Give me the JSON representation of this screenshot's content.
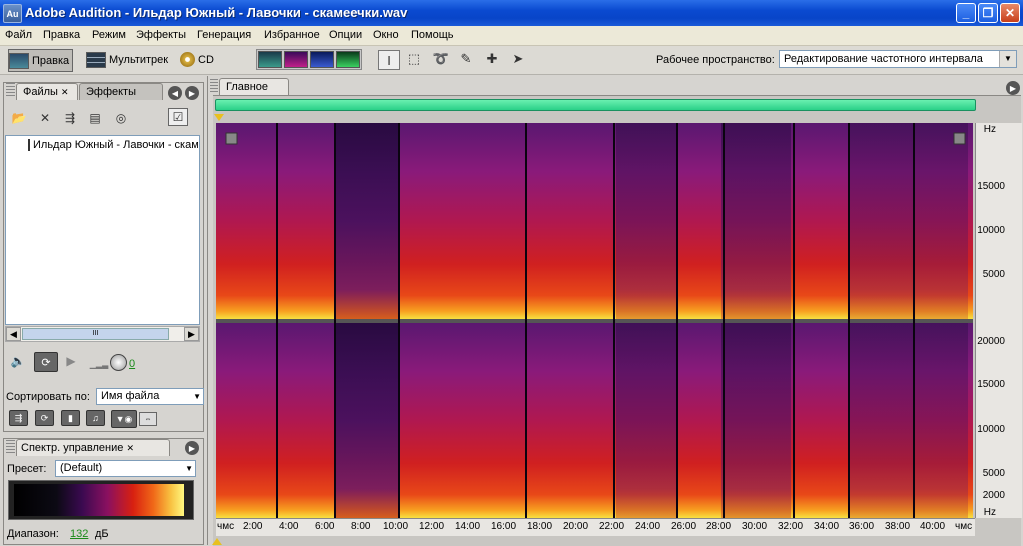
{
  "window": {
    "icon": "Au",
    "title": "Adobe Audition - Ильдар Южный - Лавочки - скамеечки.wav"
  },
  "menu": [
    "Файл",
    "Правка",
    "Режим",
    "Эффекты",
    "Генерация",
    "Избранное",
    "Опции",
    "Окно",
    "Помощь"
  ],
  "toolbar": {
    "edit_label": "Правка",
    "multitrack_label": "Мультитрек",
    "cd_label": "CD",
    "workspace_label": "Рабочее пространство:",
    "workspace_value": "Редактирование частотного интервала"
  },
  "left_panel": {
    "tabs": [
      "Файлы",
      "Эффекты"
    ],
    "file_item": "Ильдар Южный - Лавочки - скамеечки",
    "scroll_label": "III",
    "volume_value": "0",
    "sort_label": "Сортировать по:",
    "sort_value": "Имя файла"
  },
  "spectral_panel": {
    "tab": "Спектр. управление",
    "preset_label": "Пресет:",
    "preset_value": "(Default)",
    "range_label": "Диапазон:",
    "range_value": "132",
    "range_unit": "дБ"
  },
  "main": {
    "tab": "Главное",
    "hz_top": [
      "Hz",
      "15000",
      "10000",
      "5000"
    ],
    "hz_bottom": [
      "20000",
      "15000",
      "10000",
      "5000",
      "2000",
      "Hz"
    ],
    "time_labels": [
      "чмс",
      "2:00",
      "4:00",
      "6:00",
      "8:00",
      "10:00",
      "12:00",
      "14:00",
      "16:00",
      "18:00",
      "20:00",
      "22:00",
      "24:00",
      "26:00",
      "28:00",
      "30:00",
      "32:00",
      "34:00",
      "36:00",
      "38:00",
      "40:00",
      "чмс"
    ]
  }
}
